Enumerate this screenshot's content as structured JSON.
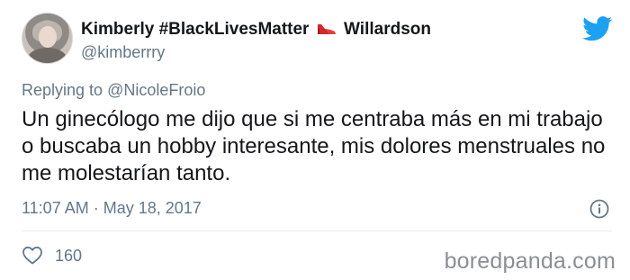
{
  "author": {
    "name_first": "Kimberly",
    "name_hashtag": "#BlackLivesMatter",
    "name_last": "Willardson",
    "handle": "@kimberrry"
  },
  "reply": {
    "prefix": "Replying to",
    "mention": "@NicoleFroio"
  },
  "tweet": {
    "text": "Un ginecólogo me dijo que si me centraba más en mi trabajo o buscaba un hobby interesante, mis dolores menstruales no me molestarían tanto.",
    "timestamp": "11:07 AM · May 18, 2017"
  },
  "actions": {
    "likes": "160"
  },
  "watermark": "boredpanda.com",
  "icons": {
    "brand": "twitter-bird-icon",
    "name_emoji": "high-heel-shoe-icon",
    "info": "info-icon",
    "like": "heart-icon"
  },
  "colors": {
    "twitter_blue": "#1da1f2",
    "secondary_text": "#657786",
    "primary_text": "#14171a",
    "shoe_red": "#d9262c"
  }
}
